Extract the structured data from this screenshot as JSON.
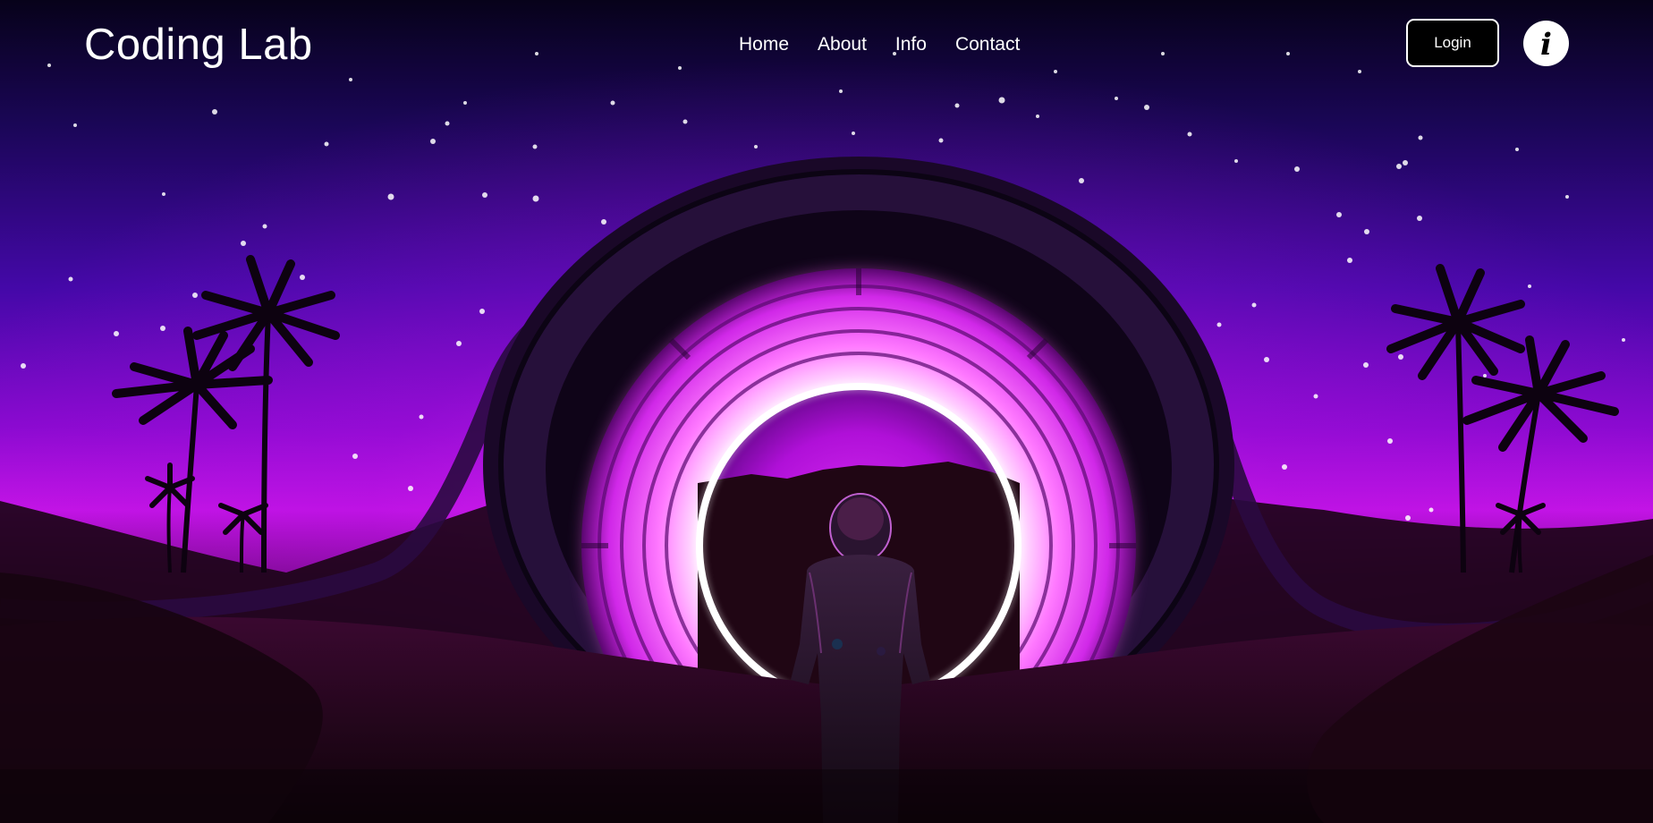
{
  "header": {
    "logo_text": "Coding Lab",
    "nav_links": [
      {
        "label": "Home"
      },
      {
        "label": "About"
      },
      {
        "label": "Info"
      },
      {
        "label": "Contact"
      }
    ],
    "login_label": "Login",
    "info_glyph": "i"
  },
  "hero": {
    "background": "astronaut-standing-before-glowing-portal",
    "colors": {
      "sky_top": "#0d0530",
      "sky_mid": "#4a0aa8",
      "sky_glow": "#c010e0",
      "portal_glow": "#f060ff",
      "ring": "#ffffff",
      "ground": "#1a0510"
    }
  }
}
